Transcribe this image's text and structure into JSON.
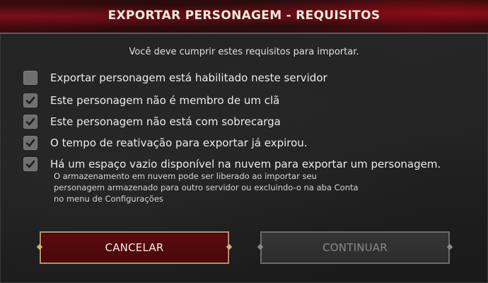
{
  "dialog": {
    "title": "EXPORTAR PERSONAGEM - REQUISITOS",
    "subtitle": "Você deve cumprir estes requisitos para importar."
  },
  "requirements": [
    {
      "label": "Exportar personagem está habilitado neste servidor",
      "checked": false
    },
    {
      "label": "Este personagem não é membro de um clã",
      "checked": true
    },
    {
      "label": "Este personagem não está com sobrecarga",
      "checked": true
    },
    {
      "label": "O tempo de reativação para exportar já expirou.",
      "checked": true
    },
    {
      "label": "Há um espaço vazio disponível na nuvem para exportar um personagem.",
      "checked": true
    }
  ],
  "note": {
    "lines": [
      "O armazenamento em nuvem pode ser liberado ao importar seu",
      "personagem armazenado para outro servidor ou excluindo-o na aba Conta",
      "no menu de Configurações"
    ]
  },
  "buttons": {
    "cancel_label": "CANCELAR",
    "continue_label": "CONTINUAR",
    "continue_enabled": false
  },
  "colors": {
    "accent_red": "#5a0a0e",
    "gold_border": "#b7936a",
    "checkbox": "#6f6f6f"
  }
}
